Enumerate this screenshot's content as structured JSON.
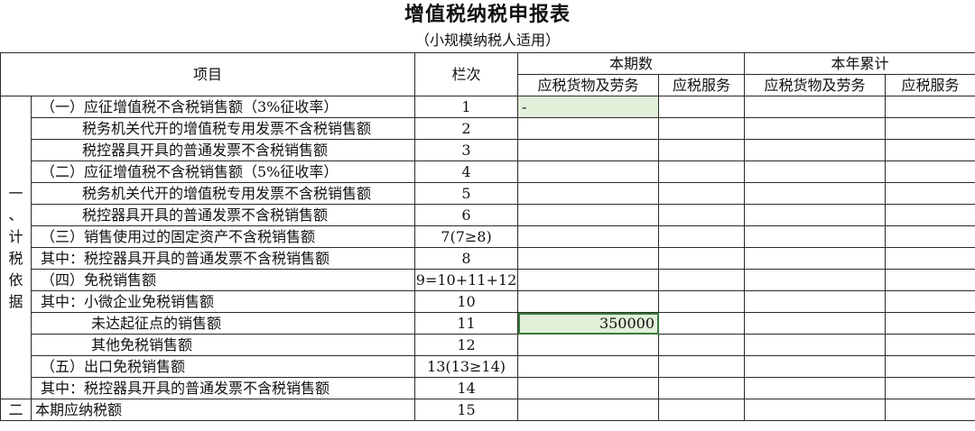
{
  "title": "增值税纳税申报表",
  "subtitle": "（小规模纳税人适用）",
  "headers": {
    "item": "项目",
    "column_no": "栏次",
    "current_period": "本期数",
    "year_to_date": "本年累计",
    "goods_labor": "应税货物及劳务",
    "services": "应税服务"
  },
  "category_one": [
    "一",
    "、",
    "计",
    "税",
    "依",
    "据"
  ],
  "category_two": "二",
  "rows": [
    {
      "label": "（一）应征增值税不含税销售额（3%征收率）",
      "col": "1",
      "goods": "-",
      "services": "",
      "ytd_goods": "",
      "ytd_services": ""
    },
    {
      "label": "税务机关代开的增值税专用发票不含税销售额",
      "col": "2",
      "goods": "",
      "services": "",
      "ytd_goods": "",
      "ytd_services": ""
    },
    {
      "label": "税控器具开具的普通发票不含税销售额",
      "col": "3",
      "goods": "",
      "services": "",
      "ytd_goods": "",
      "ytd_services": ""
    },
    {
      "label": "（二）应征增值税不含税销售额（5%征收率）",
      "col": "4",
      "goods": "",
      "services": "",
      "ytd_goods": "",
      "ytd_services": ""
    },
    {
      "label": "税务机关代开的增值税专用发票不含税销售额",
      "col": "5",
      "goods": "",
      "services": "",
      "ytd_goods": "",
      "ytd_services": ""
    },
    {
      "label": "税控器具开具的普通发票不含税销售额",
      "col": "6",
      "goods": "",
      "services": "",
      "ytd_goods": "",
      "ytd_services": ""
    },
    {
      "label": "（三）销售使用过的固定资产不含税销售额",
      "col": "7(7≥8)",
      "goods": "",
      "services": "",
      "ytd_goods": "",
      "ytd_services": ""
    },
    {
      "label": "其中：税控器具开具的普通发票不含税销售额",
      "col": "8",
      "goods": "",
      "services": "",
      "ytd_goods": "",
      "ytd_services": ""
    },
    {
      "label": "（四）免税销售额",
      "col": "9=10+11+12",
      "goods": "",
      "services": "",
      "ytd_goods": "",
      "ytd_services": ""
    },
    {
      "label": "其中：小微企业免税销售额",
      "col": "10",
      "goods": "",
      "services": "",
      "ytd_goods": "",
      "ytd_services": ""
    },
    {
      "label": "未达起征点的销售额",
      "col": "11",
      "goods": "350000",
      "services": "",
      "ytd_goods": "",
      "ytd_services": ""
    },
    {
      "label": "其他免税销售额",
      "col": "12",
      "goods": "",
      "services": "",
      "ytd_goods": "",
      "ytd_services": ""
    },
    {
      "label": "（五）出口免税销售额",
      "col": "13(13≥14)",
      "goods": "",
      "services": "",
      "ytd_goods": "",
      "ytd_services": ""
    },
    {
      "label": "其中：税控器具开具的普通发票不含税销售额",
      "col": "14",
      "goods": "",
      "services": "",
      "ytd_goods": "",
      "ytd_services": ""
    },
    {
      "label": "本期应纳税额",
      "col": "15",
      "goods": "",
      "services": "",
      "ytd_goods": "",
      "ytd_services": ""
    }
  ],
  "colors": {
    "highlight": "#e2efd9",
    "grid": "#2a2a2a"
  }
}
